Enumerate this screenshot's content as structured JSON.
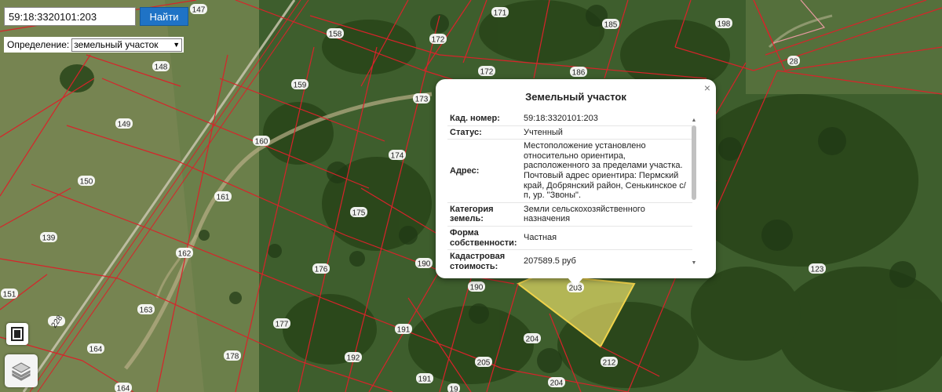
{
  "search": {
    "value": "59:18:3320101:203",
    "button_label": "Найти"
  },
  "definition": {
    "label": "Определение:",
    "selected": "земельный участок"
  },
  "map": {
    "parcel_labels": [
      "147",
      "171",
      "185",
      "198",
      "158",
      "172",
      "148",
      "28",
      "172",
      "186",
      "159",
      "173",
      "149",
      "160",
      "174",
      "150",
      "161",
      "175",
      "139",
      "162",
      "176",
      "190",
      "123",
      "151",
      "163",
      "190",
      "228",
      "177",
      "191",
      "203",
      "204",
      "164",
      "178",
      "192",
      "205",
      "212",
      "191",
      "204",
      "164",
      "19"
    ],
    "selected_parcel_color": "#f2e56b",
    "boundary_color": "#d8232a"
  },
  "popup": {
    "title": "Земельный участок",
    "close_symbol": "×",
    "rows": [
      {
        "key": "Кад. номер:",
        "value": "59:18:3320101:203"
      },
      {
        "key": "Статус:",
        "value": "Учтенный"
      },
      {
        "key": "Адрес:",
        "value": "Местоположение установлено относительно ориентира, расположенного за пределами участка. Почтовый адрес ориентира: Пермский край, Добрянский район, Сенькинское с/п, ур. \"Звоны\"."
      },
      {
        "key": "Категория земель:",
        "value": "Земли сельскохозяйственного назначения"
      },
      {
        "key": "Форма собственности:",
        "value": "Частная"
      },
      {
        "key": "Кадастровая стоимость:",
        "value": "207589.5 руб"
      }
    ]
  },
  "icons": {
    "fullscreen": "fullscreen-icon",
    "layers": "layers-icon"
  }
}
